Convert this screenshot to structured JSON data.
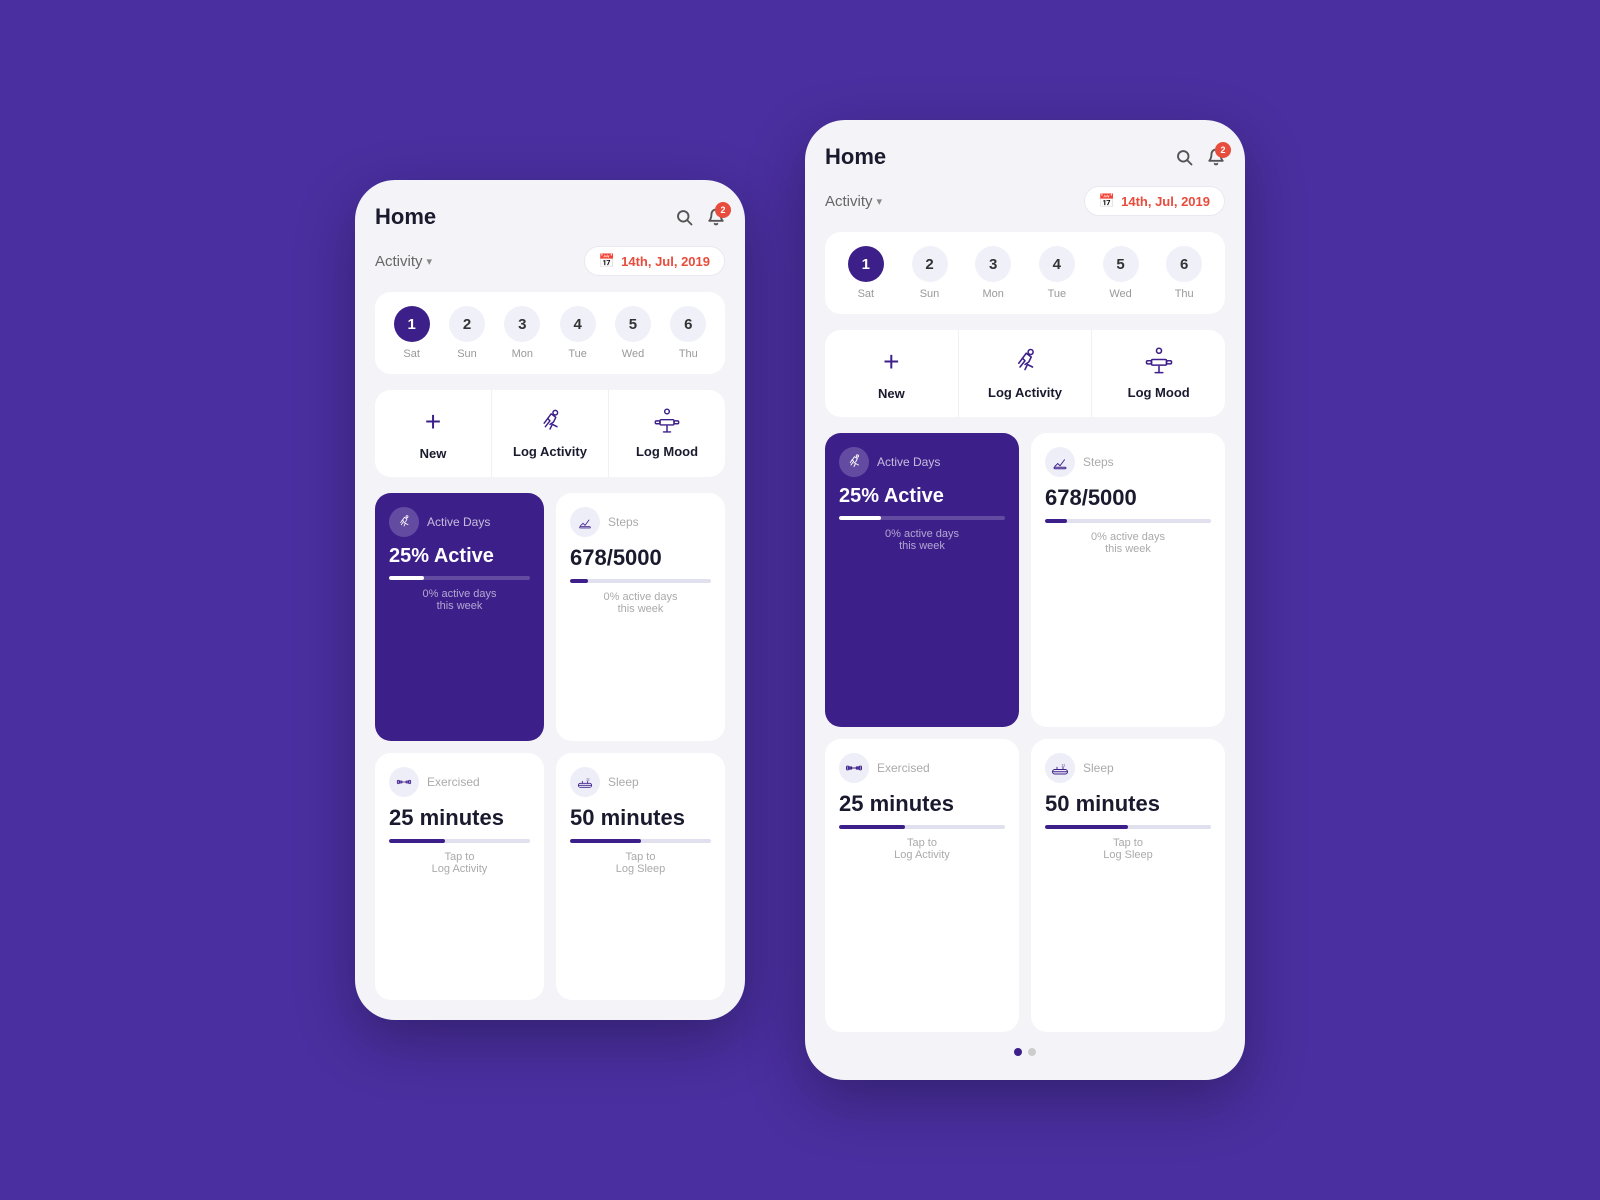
{
  "header": {
    "title": "Home",
    "badge": "2",
    "date": "14th, Jul, 2019"
  },
  "subheader": {
    "activity_label": "Activity",
    "chevron": "▾"
  },
  "calendar": {
    "days": [
      {
        "num": "1",
        "label": "Sat",
        "active": true
      },
      {
        "num": "2",
        "label": "Sun",
        "active": false
      },
      {
        "num": "3",
        "label": "Mon",
        "active": false
      },
      {
        "num": "4",
        "label": "Tue",
        "active": false
      },
      {
        "num": "5",
        "label": "Wed",
        "active": false
      },
      {
        "num": "6",
        "label": "Thu",
        "active": false
      }
    ]
  },
  "actions": [
    {
      "label": "New",
      "type": "plus"
    },
    {
      "label": "Log Activity",
      "type": "run"
    },
    {
      "label": "Log Mood",
      "type": "lift"
    }
  ],
  "stats": [
    {
      "label": "Active Days",
      "value": "25% Active",
      "sub": "0% active days\nthis week",
      "progress": 25,
      "dark": true,
      "icon": "run"
    },
    {
      "label": "Steps",
      "value": "678/5000",
      "sub": "0% active days\nthis week",
      "progress": 13,
      "dark": false,
      "icon": "steps"
    },
    {
      "label": "Exercised",
      "value": "25 minutes",
      "sub": "Tap to\nLog Activity",
      "progress": 40,
      "dark": false,
      "icon": "dumbbell"
    },
    {
      "label": "Sleep",
      "value": "50 minutes",
      "sub": "Tap to\nLog Sleep",
      "progress": 50,
      "dark": false,
      "icon": "sleep"
    }
  ],
  "dots": [
    true,
    false
  ]
}
